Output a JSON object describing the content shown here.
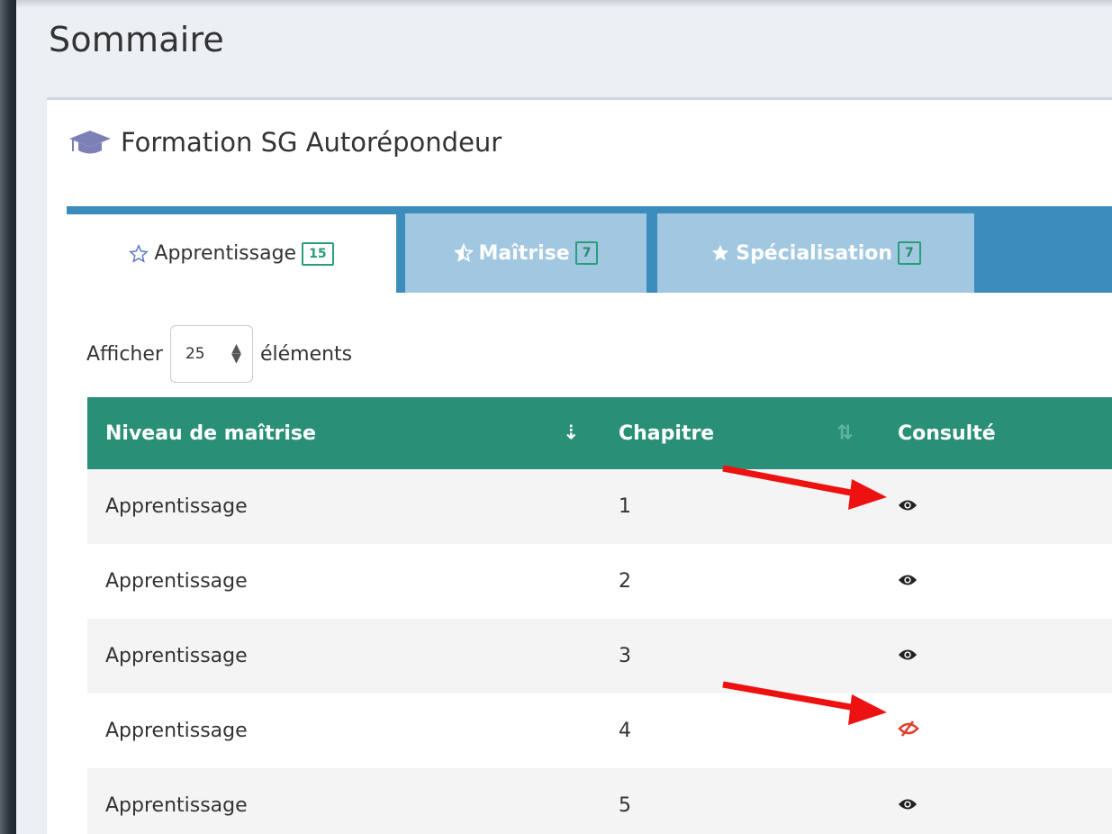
{
  "page": {
    "title": "Sommaire"
  },
  "box": {
    "title": "Formation SG Autorépondeur",
    "icon": "graduation-cap-icon"
  },
  "tabs": [
    {
      "label": "Apprentissage",
      "count": "15",
      "icon": "star-outline-icon",
      "active": true
    },
    {
      "label": "Maîtrise",
      "count": "7",
      "icon": "star-half-icon",
      "active": false
    },
    {
      "label": "Spécialisation",
      "count": "7",
      "icon": "star-icon",
      "active": false
    }
  ],
  "length": {
    "prefix": "Afficher",
    "value": "25",
    "suffix": "éléments"
  },
  "table": {
    "columns": [
      "Niveau de maîtrise",
      "Chapitre",
      "Consulté"
    ],
    "rows": [
      {
        "level": "Apprentissage",
        "chapter": "1",
        "viewed": true
      },
      {
        "level": "Apprentissage",
        "chapter": "2",
        "viewed": true
      },
      {
        "level": "Apprentissage",
        "chapter": "3",
        "viewed": true
      },
      {
        "level": "Apprentissage",
        "chapter": "4",
        "viewed": false
      },
      {
        "level": "Apprentissage",
        "chapter": "5",
        "viewed": true
      }
    ]
  },
  "colors": {
    "tab_bar": "#3c8dbc",
    "tab_inactive": "#a1c8e0",
    "table_header": "#2a8f77",
    "badge": "#2a9d7a",
    "not_viewed": "#e0412e",
    "annotation_arrow": "#ee1111"
  }
}
